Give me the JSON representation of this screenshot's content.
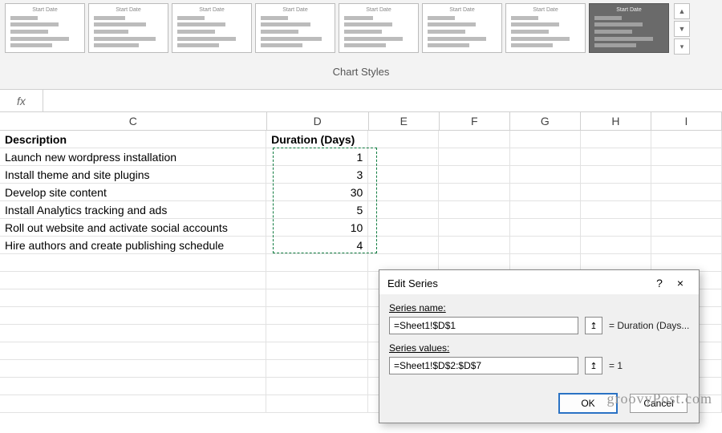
{
  "ribbon": {
    "label": "Chart Styles",
    "scroll": {
      "up": "▲",
      "down": "▼",
      "more": "▾"
    }
  },
  "formula_bar": {
    "fx": "fx",
    "value": ""
  },
  "columns": [
    "C",
    "D",
    "E",
    "F",
    "G",
    "H",
    "I"
  ],
  "headers": {
    "C": "Description",
    "D": "Duration (Days)"
  },
  "rows": [
    {
      "desc": "Launch new wordpress installation",
      "dur": "1"
    },
    {
      "desc": "Install theme and site plugins",
      "dur": "3"
    },
    {
      "desc": "Develop site content",
      "dur": "30"
    },
    {
      "desc": "Install Analytics tracking and ads",
      "dur": "5"
    },
    {
      "desc": "Roll out website and activate social accounts",
      "dur": "10"
    },
    {
      "desc": "Hire authors and create publishing schedule",
      "dur": "4"
    }
  ],
  "dialog": {
    "title": "Edit Series",
    "help": "?",
    "close": "×",
    "series_name_label": "Series name:",
    "series_name_value": "=Sheet1!$D$1",
    "series_name_preview": "= Duration (Days...",
    "series_values_label": "Series values:",
    "series_values_value": "=Sheet1!$D$2:$D$7",
    "series_values_preview": "= 1",
    "ok": "OK",
    "cancel": "Cancel"
  },
  "watermark": "groovyPost.com",
  "thumb_title": "Start Date",
  "chart_data": {
    "type": "bar",
    "categories": [
      "Launch new wordpress installation",
      "Install theme and site plugins",
      "Develop site content",
      "Install Analytics tracking and ads",
      "Roll out website and activate social accounts",
      "Hire authors and create publishing schedule"
    ],
    "series": [
      {
        "name": "Duration (Days)",
        "values": [
          1,
          3,
          30,
          5,
          10,
          4
        ]
      }
    ],
    "title": "",
    "xlabel": "",
    "ylabel": ""
  }
}
